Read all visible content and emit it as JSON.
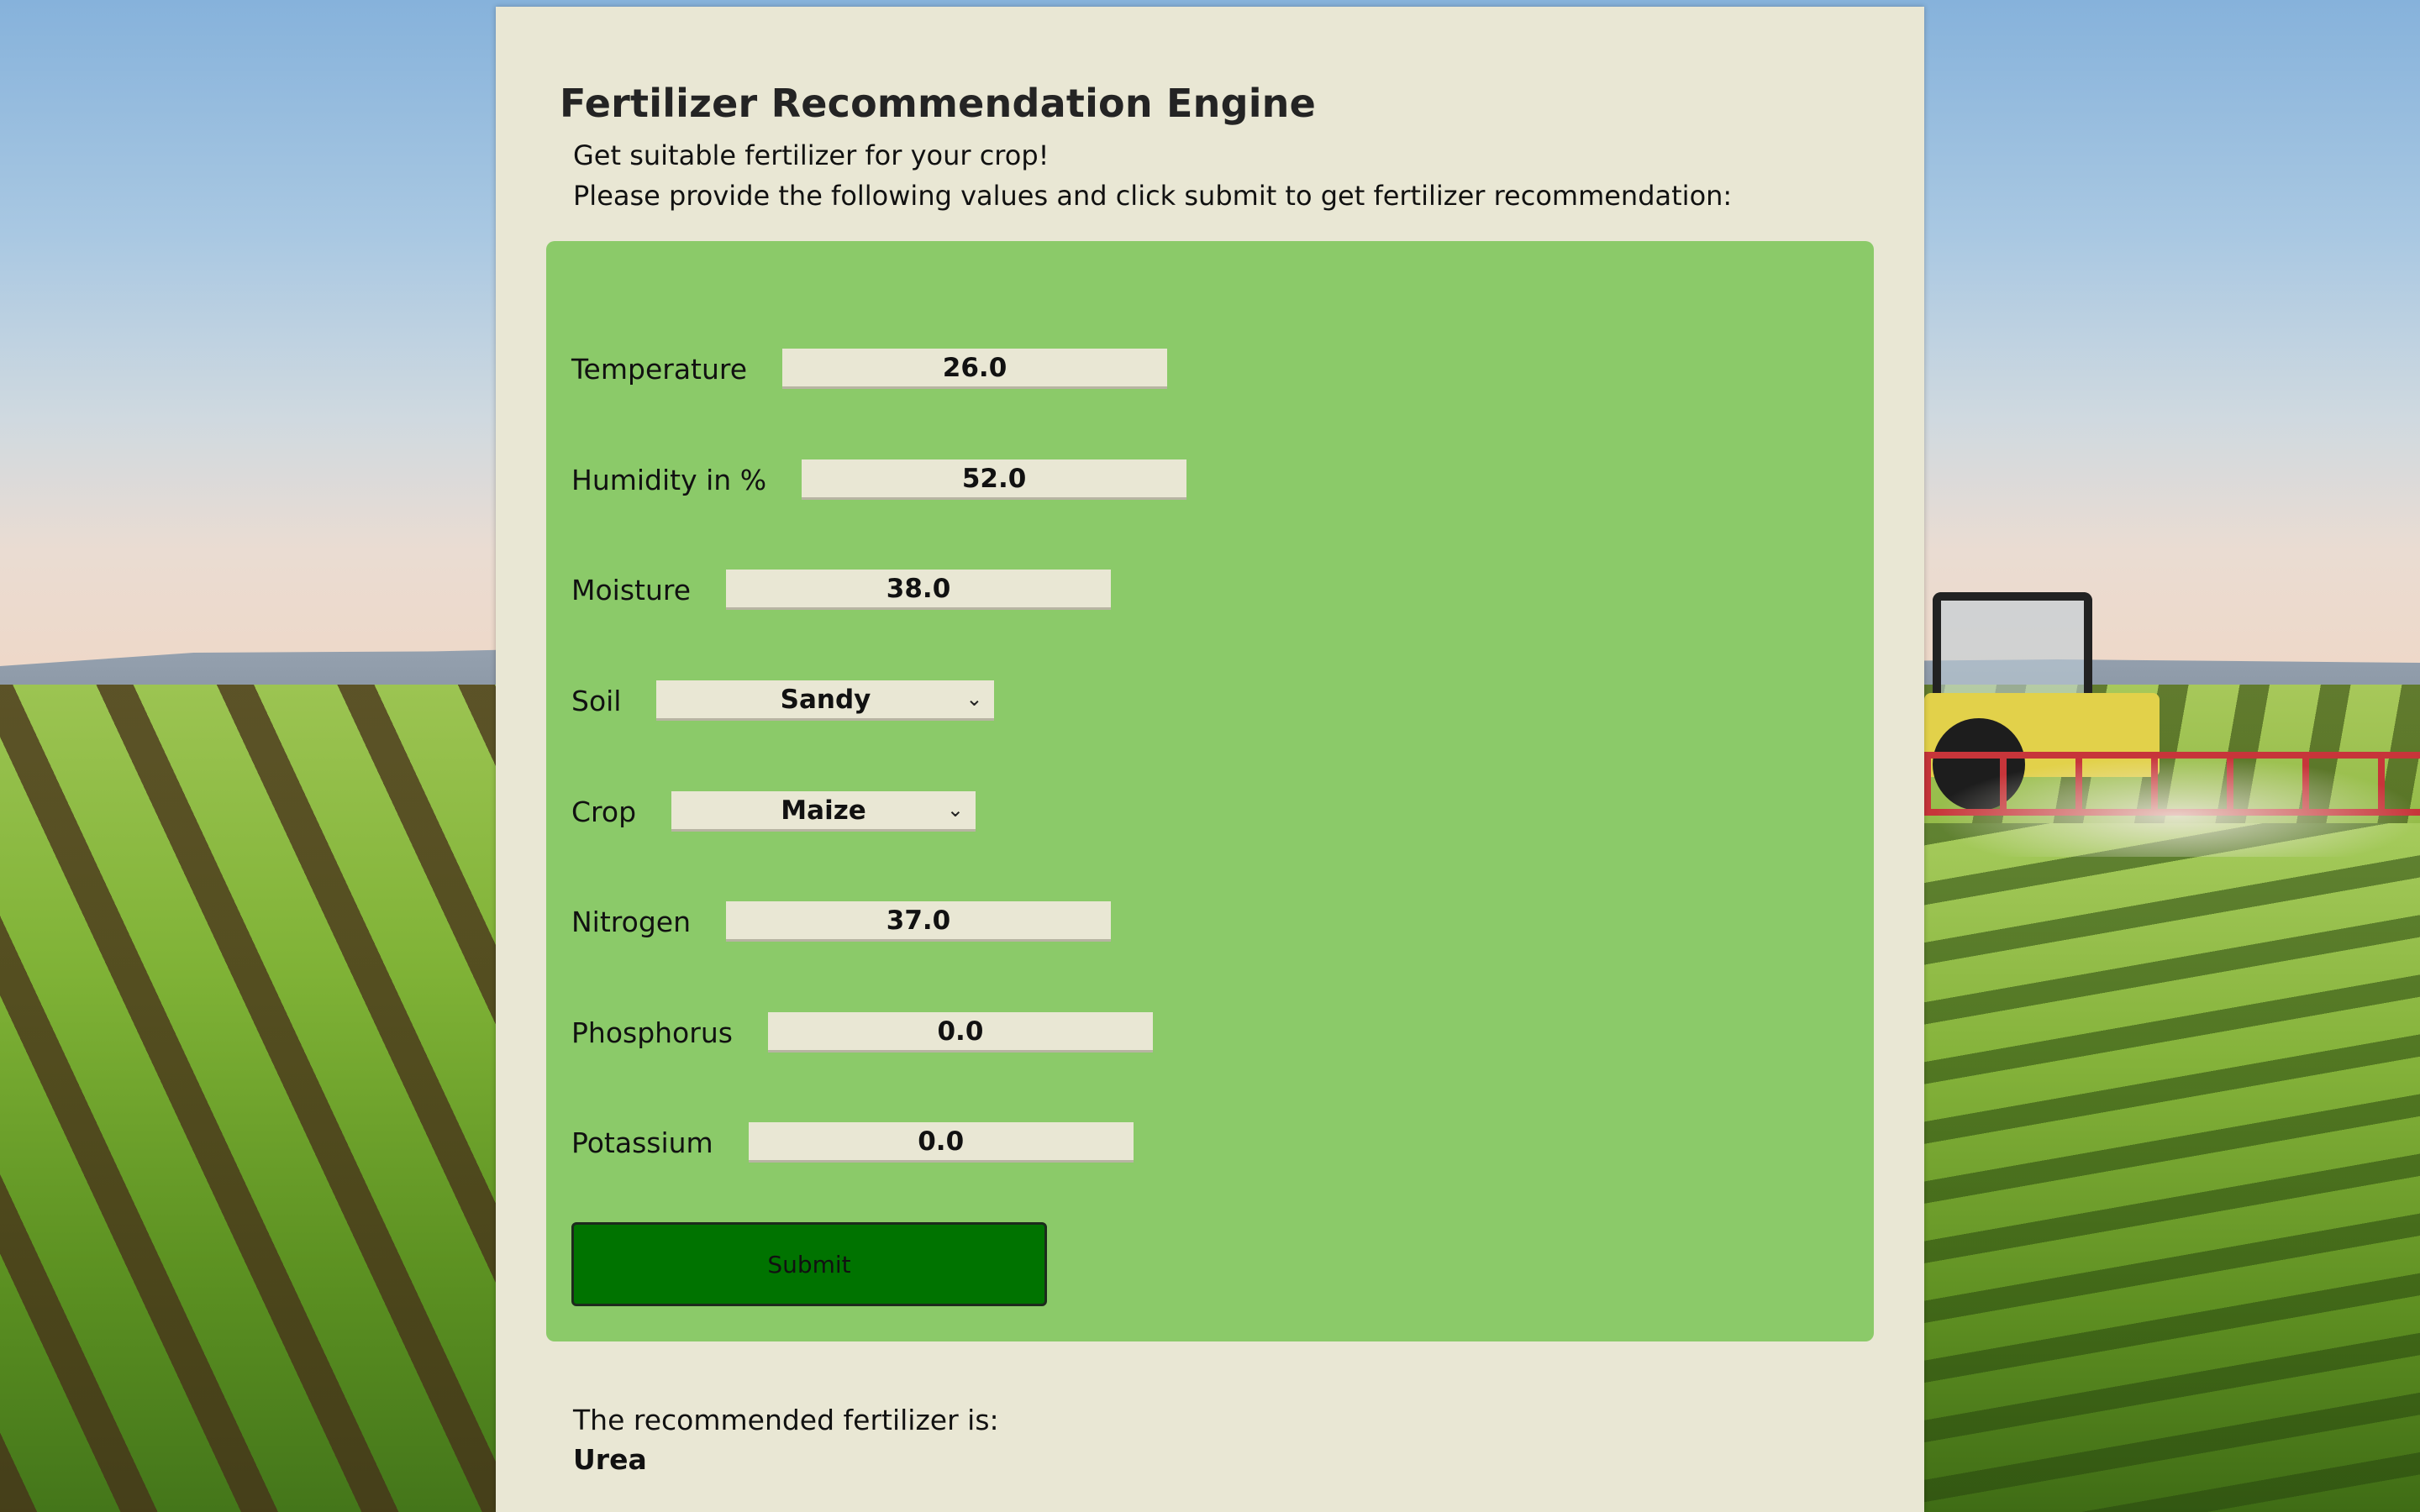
{
  "page": {
    "title": "Fertilizer Recommendation Engine",
    "subtitle": "Get suitable fertilizer for your crop!",
    "instructions": "Please provide the following values and click submit to get fertilizer recommendation:"
  },
  "form": {
    "temperature": {
      "label": "Temperature",
      "value": "26.0"
    },
    "humidity": {
      "label": "Humidity in %",
      "value": "52.0"
    },
    "moisture": {
      "label": "Moisture",
      "value": "38.0"
    },
    "soil": {
      "label": "Soil",
      "selected": "Sandy"
    },
    "crop": {
      "label": "Crop",
      "selected": "Maize"
    },
    "nitrogen": {
      "label": "Nitrogen",
      "value": "37.0"
    },
    "phosphorus": {
      "label": "Phosphorus",
      "value": "0.0"
    },
    "potassium": {
      "label": "Potassium",
      "value": "0.0"
    },
    "submit_label": "Submit"
  },
  "result": {
    "label": "The recommended fertilizer is:",
    "value": "Urea"
  },
  "colors": {
    "card_background": "#e9e7d4",
    "form_panel": "#8bca69",
    "submit_button": "#007300"
  },
  "icons": {
    "dropdown": "chevron-down-icon"
  }
}
